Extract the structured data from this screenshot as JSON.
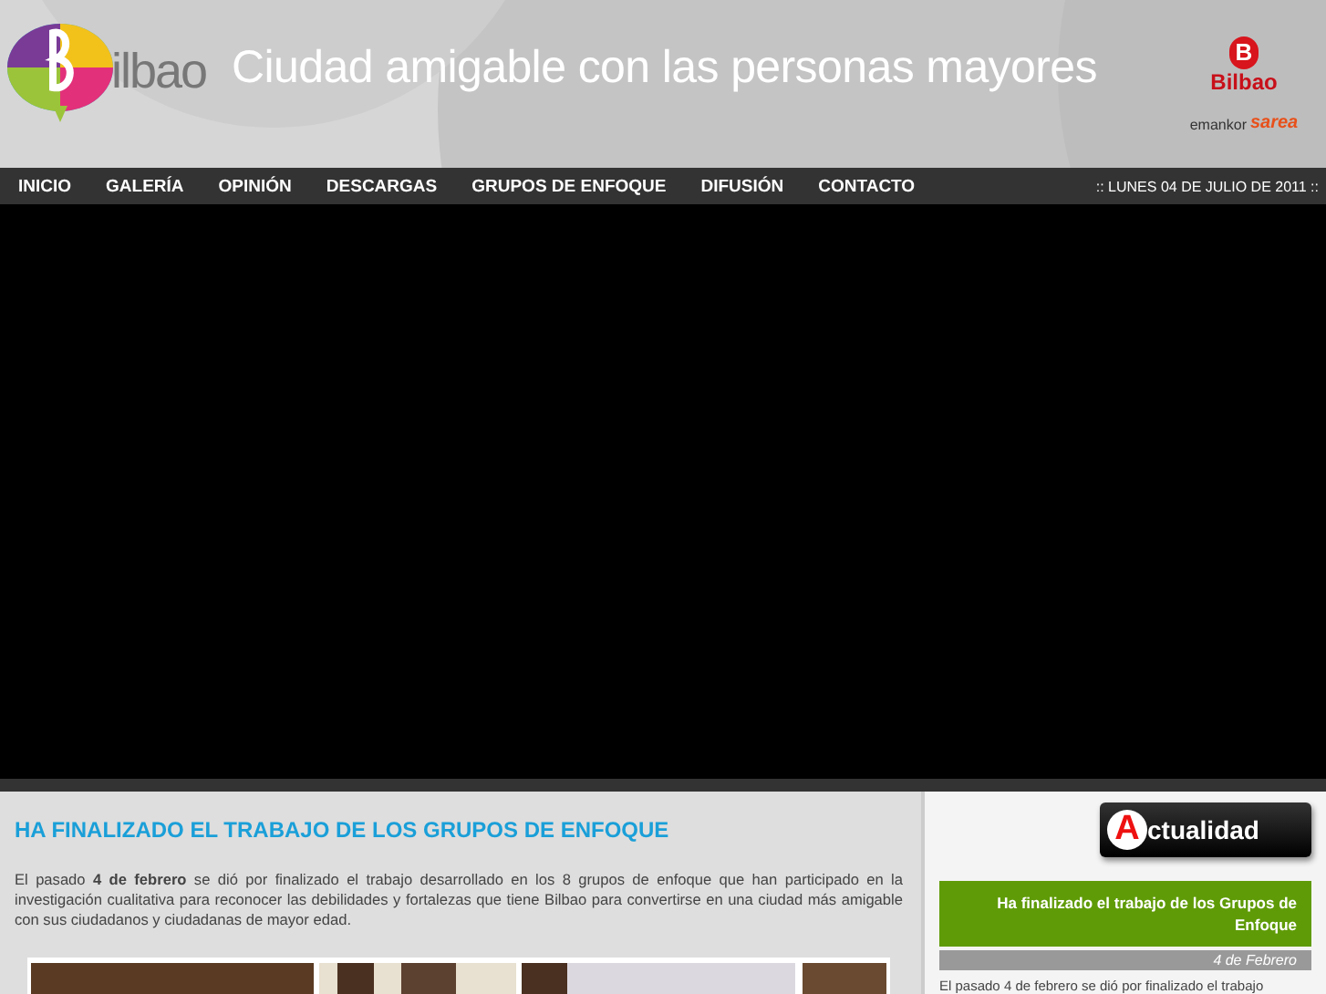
{
  "header": {
    "logo_text": "ilbao",
    "title": "Ciudad amigable con las personas mayores",
    "city_logo": {
      "letter": "B",
      "name": "Bilbao"
    },
    "partner_logo": {
      "first": "emankor",
      "second": "sarea"
    }
  },
  "nav": {
    "items": [
      {
        "label": "INICIO"
      },
      {
        "label": "GALERÍA"
      },
      {
        "label": "OPINIÓN"
      },
      {
        "label": "DESCARGAS"
      },
      {
        "label": "GRUPOS DE ENFOQUE"
      },
      {
        "label": "DIFUSIÓN"
      },
      {
        "label": "CONTACTO"
      }
    ],
    "date": ":: LUNES 04 DE JULIO DE 2011 ::"
  },
  "video": {
    "kind": "blank"
  },
  "article": {
    "title": "HA FINALIZADO EL TRABAJO DE LOS GRUPOS DE ENFOQUE",
    "body": "El pasado **4 de febrero** se dió por finalizado el trabajo desarrollado en los 8 grupos de enfoque que han participado en la investigación cualitativa para reconocer las debilidades y fortalezas que tiene Bilbao para convertirse en una ciudad más amigable con sus ciudadanos y ciudadanas de mayor edad."
  },
  "sidebar": {
    "badge": {
      "letter": "A",
      "label": "ctualidad"
    },
    "news": {
      "title": "Ha finalizado el trabajo de los Grupos de Enfoque",
      "date": "4 de Febrero",
      "excerpt": "El pasado 4 de febrero se dió por finalizado el trabajo"
    }
  }
}
